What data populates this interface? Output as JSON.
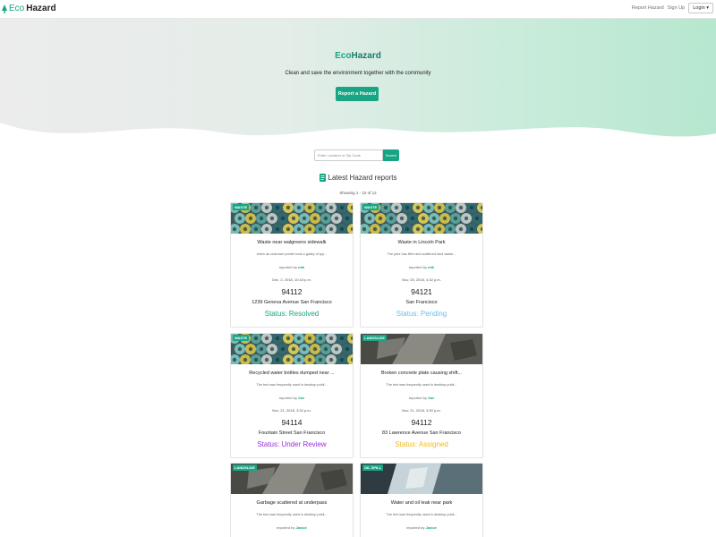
{
  "navbar": {
    "brand_eco": "Eco",
    "brand_hazard": "Hazard",
    "links": [
      "Report Hazard",
      "Sign Up"
    ],
    "login_label": "Login ▾"
  },
  "hero": {
    "title_eco": "Eco",
    "title_hazard": "Hazard",
    "subtitle": "Clean and save the environment together with the community",
    "cta_label": "Report a Hazard"
  },
  "search": {
    "placeholder": "Enter Location or Zip Code",
    "button_label": "Search"
  },
  "latest_heading": "Latest Hazard reports",
  "showing_text": "Showing 1 - 10 of 12",
  "reported_by_prefix": "reported by",
  "colors": {
    "accent": "#17a583",
    "resolved": "#17a583",
    "pending": "#6cbde8",
    "under_review": "#9b2fd0",
    "assigned": "#f4b821"
  },
  "cards": [
    {
      "badge": "WASTE",
      "image": "waste-bottles",
      "title": "Waste near walgreens sidewalk",
      "desc": "when an unknown printer took a galley of typ...",
      "user": "mtk",
      "date": "Dec. 2, 2018, 10:18 p.m.",
      "zip": "94112",
      "address": "1239 Geneva Avenue San Francisco",
      "status": "Status: Resolved",
      "status_color": "#17a583"
    },
    {
      "badge": "WASTE",
      "image": "waste-bottles",
      "title": "Waste in Lincoln Park",
      "desc": "The park has litter and scattered land waste...",
      "user": "mtk",
      "date": "Nov. 25, 2018, 4:32 p.m.",
      "zip": "94121",
      "address": "San Francisco",
      "status": "Status: Pending",
      "status_color": "#6cbde8"
    },
    {
      "badge": "WASTE",
      "image": "waste-bottles",
      "title": "Recycled water bottles dumped near ...",
      "desc": "The text was frequently used in desktop publi...",
      "user": "Xav",
      "date": "Nov. 21, 2018, 3:32 p.m.",
      "zip": "94114",
      "address": "Fountain Street San Francisco",
      "status": "Status: Under Review",
      "status_color": "#9b2fd0"
    },
    {
      "badge": "LANDSLIDE",
      "image": "rocks",
      "title": "Broken concrete plate causing shift...",
      "desc": "The text was frequently used in desktop publi...",
      "user": "Xav",
      "date": "Nov. 21, 2018, 3:30 p.m.",
      "zip": "94112",
      "address": "83 Lawrence Avenue San Francisco",
      "status": "Status: Assigned",
      "status_color": "#f4b821"
    },
    {
      "badge": "LANDSLIDE",
      "image": "rocks",
      "title": "Garbage scattered at underpass",
      "desc": "The text was frequently used in desktop publi...",
      "user": "Janice",
      "date": "",
      "zip": "",
      "address": "",
      "status": "",
      "status_color": "#17a583"
    },
    {
      "badge": "OIL SPILL",
      "image": "oil",
      "title": "Water and oil leak near park",
      "desc": "The text was frequently used in desktop publi...",
      "user": "Janice",
      "date": "",
      "zip": "",
      "address": "",
      "status": "",
      "status_color": "#17a583"
    }
  ]
}
